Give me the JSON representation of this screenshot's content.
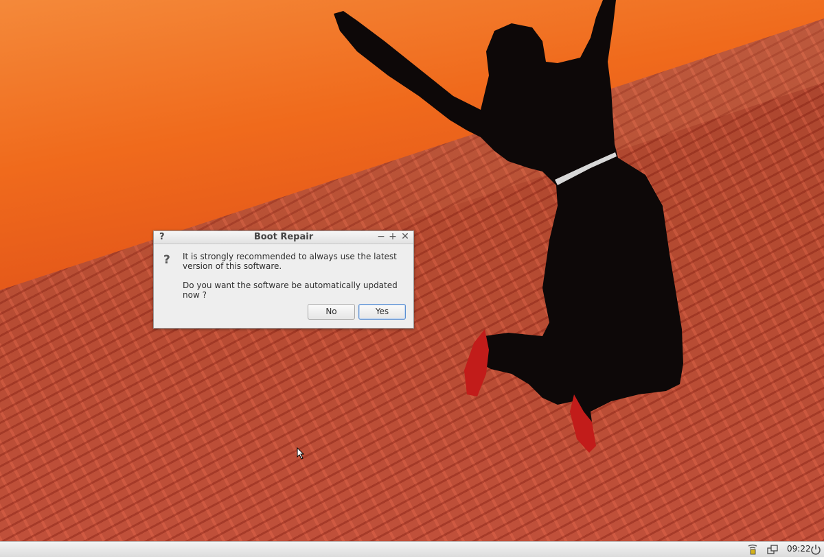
{
  "dialog": {
    "title": "Boot Repair",
    "title_icon": "?",
    "question_icon": "?",
    "message_line1": "It is strongly recommended to always use the latest version of this software.",
    "message_line2": "Do you want the software be automatically updated now ?",
    "buttons": {
      "no": "No",
      "yes": "Yes"
    },
    "window_controls": {
      "minimize": "−",
      "maximize": "+",
      "close": "✕"
    }
  },
  "taskbar": {
    "clock": "09:22",
    "icons": [
      "network-icon",
      "windows-icon",
      "power-icon"
    ]
  },
  "colors": {
    "sky": "#f06a1c",
    "floor": "#b34a30",
    "dialog_bg": "#eeeeee",
    "default_button_border": "#5b8fd1"
  }
}
